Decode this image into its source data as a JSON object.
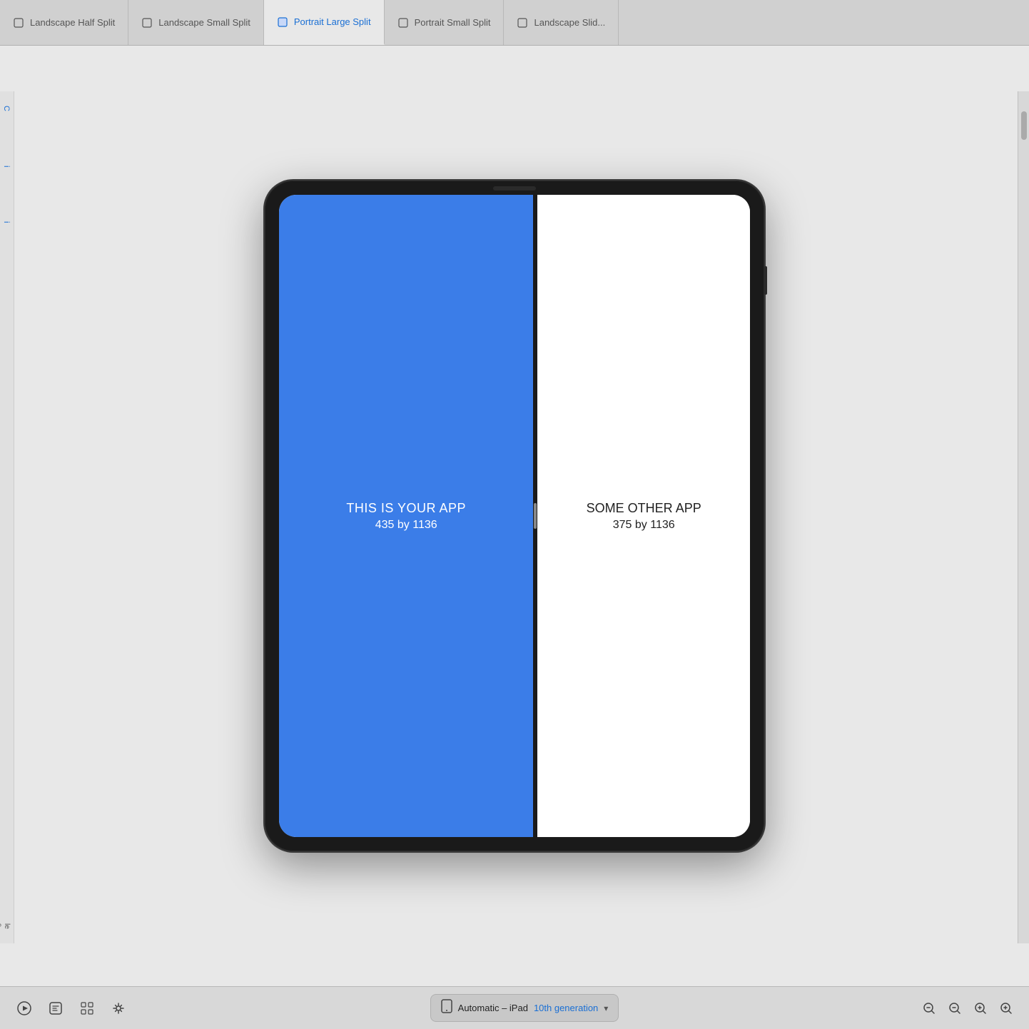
{
  "tabs": [
    {
      "id": "landscape-half-split",
      "label": "Landscape Half Split",
      "active": false,
      "icon": "tablet-icon"
    },
    {
      "id": "landscape-small-split",
      "label": "Landscape Small Split",
      "active": false,
      "icon": "tablet-icon"
    },
    {
      "id": "portrait-large-split",
      "label": "Portrait Large Split",
      "active": true,
      "icon": "tablet-active-icon"
    },
    {
      "id": "portrait-small-split",
      "label": "Portrait Small Split",
      "active": false,
      "icon": "tablet-icon"
    },
    {
      "id": "landscape-slide",
      "label": "Landscape Slid...",
      "active": false,
      "icon": "tablet-icon"
    }
  ],
  "device": {
    "name": "Automatic – iPad",
    "generation": "10th generation",
    "dropdown_arrow": "chevron"
  },
  "left_panel": {
    "title": "THIS IS YOUR APP",
    "dimensions": "435 by 1136",
    "background_color": "#3b7de8"
  },
  "right_panel": {
    "title": "SOME OTHER APP",
    "dimensions": "375 by 1136",
    "background_color": "#ffffff"
  },
  "toolbar": {
    "play_label": "Play",
    "inspect_label": "Inspect",
    "grid_label": "Grid",
    "adjust_label": "Adjust",
    "zoom_in_label": "Zoom In",
    "zoom_out_label": "Zoom Out",
    "zoom_fit_label": "Zoom Fit",
    "zoom_fill_label": "Zoom Fill"
  },
  "zoom_controls": [
    "−",
    "−",
    "+",
    "+"
  ],
  "sidebar": {
    "left_items": [
      "C",
      "i",
      "i"
    ]
  },
  "colors": {
    "active_tab": "#1a6fd4",
    "tab_bar_bg": "#d0d0d0",
    "content_bg": "#e8e8e8",
    "toolbar_bg": "#d8d8d8",
    "ipad_body": "#1a1a1a",
    "left_app_bg": "#3b7de8",
    "right_app_bg": "#ffffff"
  }
}
